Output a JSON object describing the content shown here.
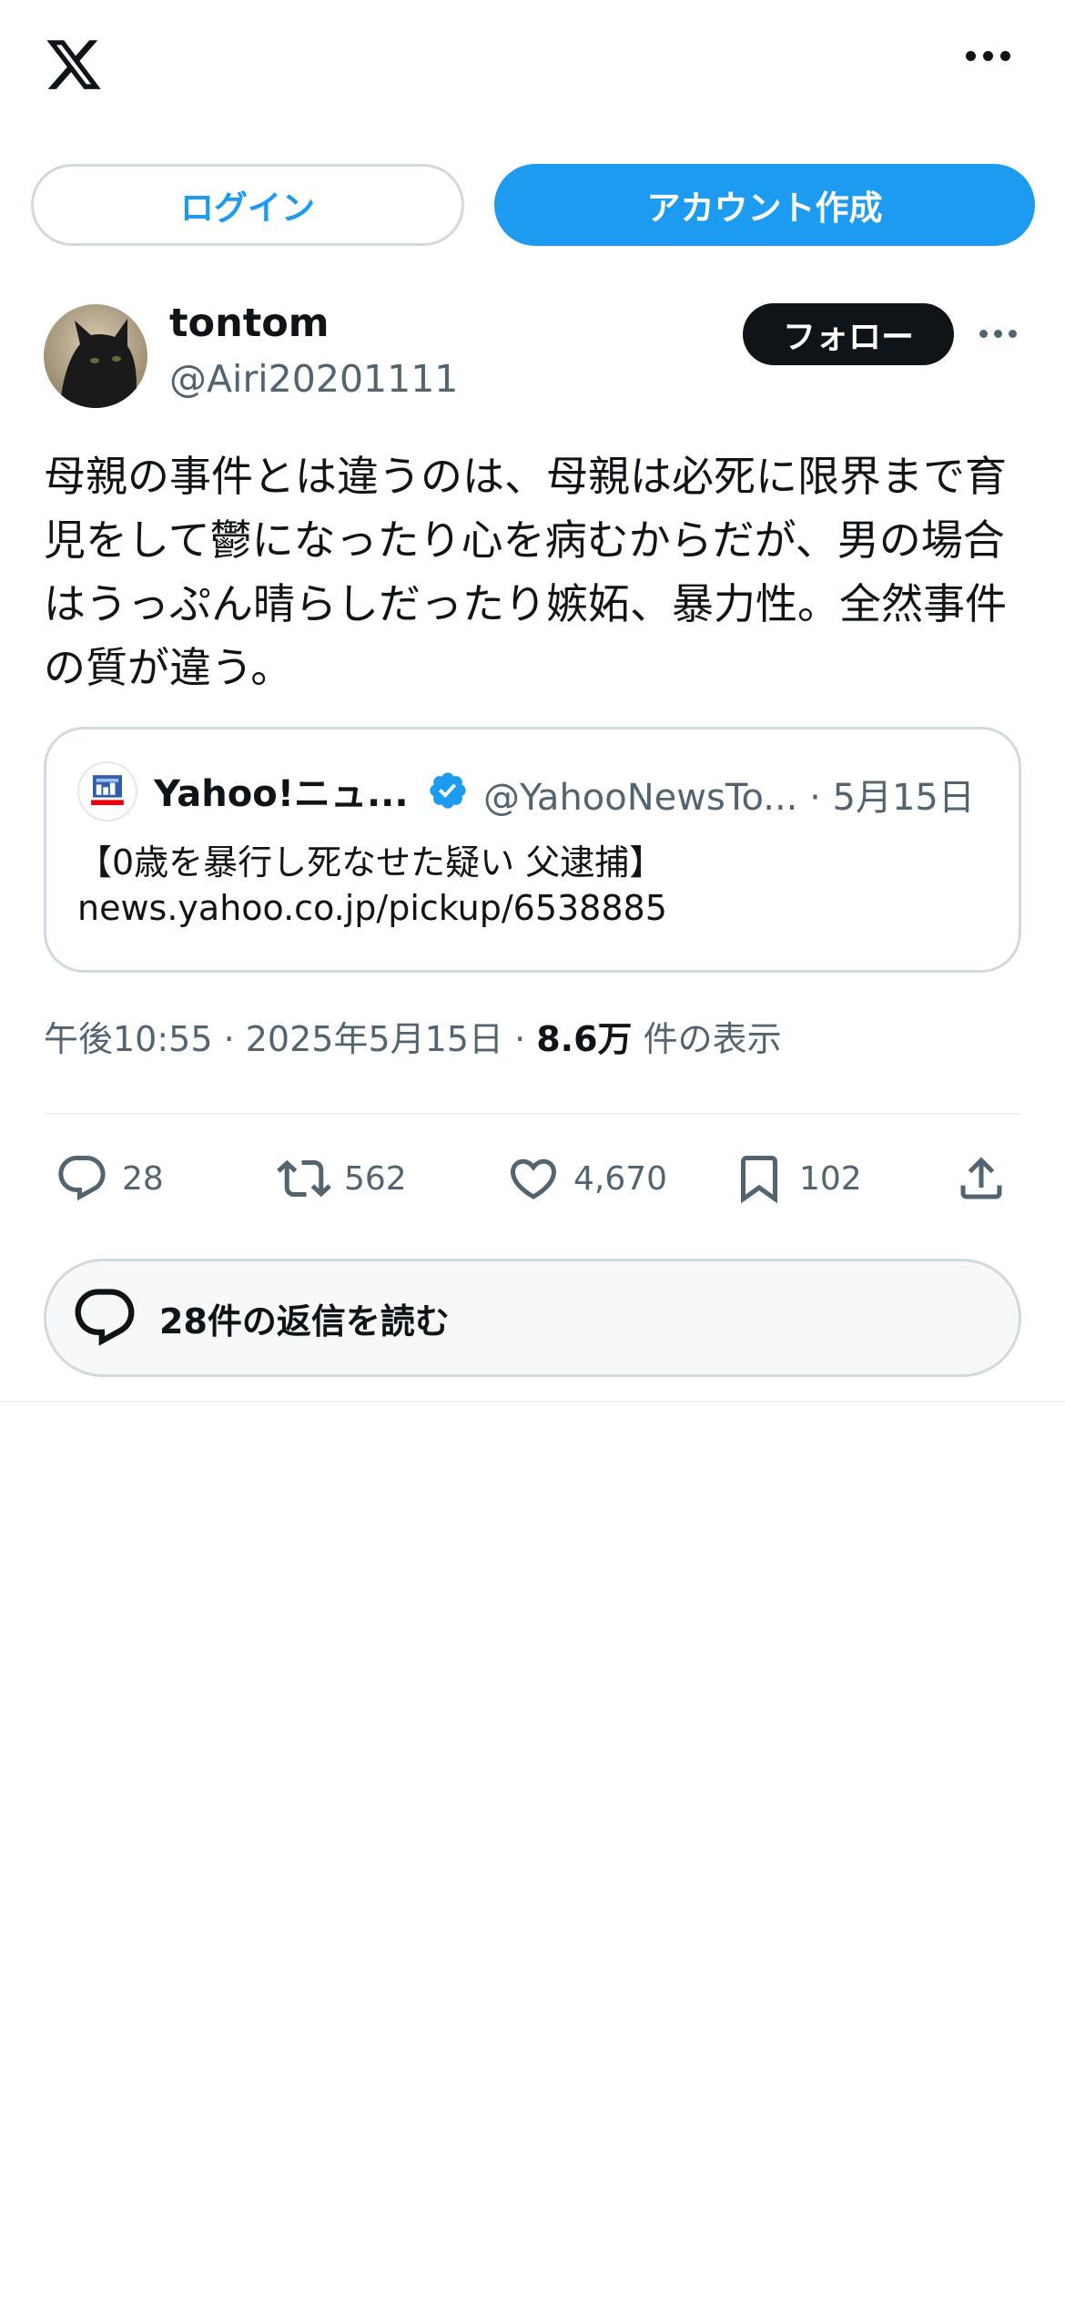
{
  "header": {
    "login_label": "ログイン",
    "signup_label": "アカウント作成"
  },
  "tweet": {
    "author_name": "tontom",
    "author_handle": "@Airi20201111",
    "follow_label": "フォロー",
    "text": "母親の事件とは違うのは、母親は必死に限界まで育児をして鬱になったり心を病むからだが、男の場合はうっぷん晴らしだったり嫉妬、暴力性。全然事件の質が違う。",
    "timestamp": "午後10:55 · 2025年5月15日 · ",
    "views_count": "8.6万",
    "views_label": " 件の表示"
  },
  "quote": {
    "name": "Yahoo!ニュ...",
    "handle_date": "@YahooNewsTo... · 5月15日",
    "line1": "【0歳を暴行し死なせた疑い 父逮捕】",
    "line2": "news.yahoo.co.jp/pickup/6538885"
  },
  "actions": {
    "replies": "28",
    "retweets": "562",
    "likes": "4,670",
    "bookmarks": "102"
  },
  "read_replies_label": "28件の返信を読む",
  "colors": {
    "accent": "#1d9bf0",
    "text": "#0f1419",
    "muted": "#536471",
    "border": "#cfd9de"
  }
}
